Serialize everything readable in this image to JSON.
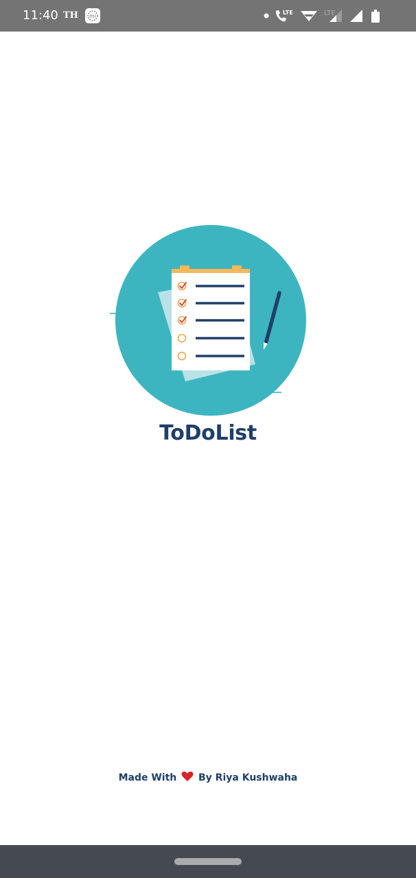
{
  "status_bar": {
    "time": "11:40",
    "carrier_label": "TH",
    "icons": [
      "mi-app-icon",
      "notification-dot-icon",
      "volte-call-icon",
      "wifi-icon",
      "lte-label-icon",
      "signal-icon",
      "signal-icon-2",
      "battery-icon"
    ],
    "lte_label": "LTE",
    "lte_label_2": "LTE",
    "background_color": "#747474"
  },
  "app": {
    "title": "ToDoList",
    "title_color": "#1f3f69",
    "logo_circle_color": "#3db5c1"
  },
  "footer": {
    "credit_prefix": "Made With",
    "credit_suffix": "By Riya Kushwaha",
    "heart_icon": "heart-icon",
    "heart_color": "#d8232a"
  },
  "nav_bar": {
    "background_color": "#454a52",
    "home_indicator": "home-pill"
  }
}
